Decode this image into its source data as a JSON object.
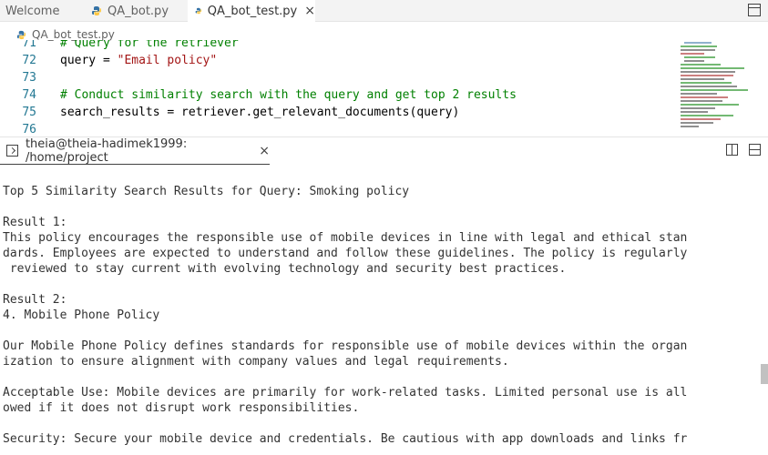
{
  "tabs": [
    {
      "label": "Welcome",
      "icon": "none",
      "active": false
    },
    {
      "label": "QA_bot.py",
      "icon": "python-icon",
      "active": false
    },
    {
      "label": "QA_bot_test.py",
      "icon": "python-icon",
      "active": true,
      "close": "×"
    }
  ],
  "breadcrumb": {
    "file": "QA_bot_test.py"
  },
  "editor": {
    "lines": [
      {
        "num": "71",
        "segments": [
          {
            "t": "# Query for the retriever",
            "k": "comment"
          }
        ]
      },
      {
        "num": "72",
        "segments": [
          {
            "t": "query = ",
            "k": "plain"
          },
          {
            "t": "\"Email policy\"",
            "k": "str"
          }
        ]
      },
      {
        "num": "73",
        "segments": []
      },
      {
        "num": "74",
        "segments": [
          {
            "t": "# Conduct similarity search with the query and get top 2 results",
            "k": "comment"
          }
        ]
      },
      {
        "num": "75",
        "segments": [
          {
            "t": "search_results = retriever.get_relevant_documents(query)",
            "k": "plain"
          }
        ]
      },
      {
        "num": "76",
        "segments": []
      }
    ]
  },
  "terminal": {
    "tab_label": "theia@theia-hadimek1999: /home/project",
    "close": "×",
    "lines": [
      "Top 5 Similarity Search Results for Query: Smoking policy",
      "",
      "Result 1:",
      "This policy encourages the responsible use of mobile devices in line with legal and ethical stan",
      "dards. Employees are expected to understand and follow these guidelines. The policy is regularly",
      " reviewed to stay current with evolving technology and security best practices.",
      "",
      "Result 2:",
      "4. Mobile Phone Policy",
      "",
      "Our Mobile Phone Policy defines standards for responsible use of mobile devices within the organ",
      "ization to ensure alignment with company values and legal requirements.",
      "",
      "Acceptable Use: Mobile devices are primarily for work-related tasks. Limited personal use is all",
      "owed if it does not disrupt work responsibilities.",
      "",
      "Security: Secure your mobile device and credentials. Be cautious with app downloads and links fr"
    ]
  },
  "colors": {
    "python_icon": "#3572a5",
    "comment": "#008000",
    "string": "#a31515",
    "line_number": "#237893"
  }
}
